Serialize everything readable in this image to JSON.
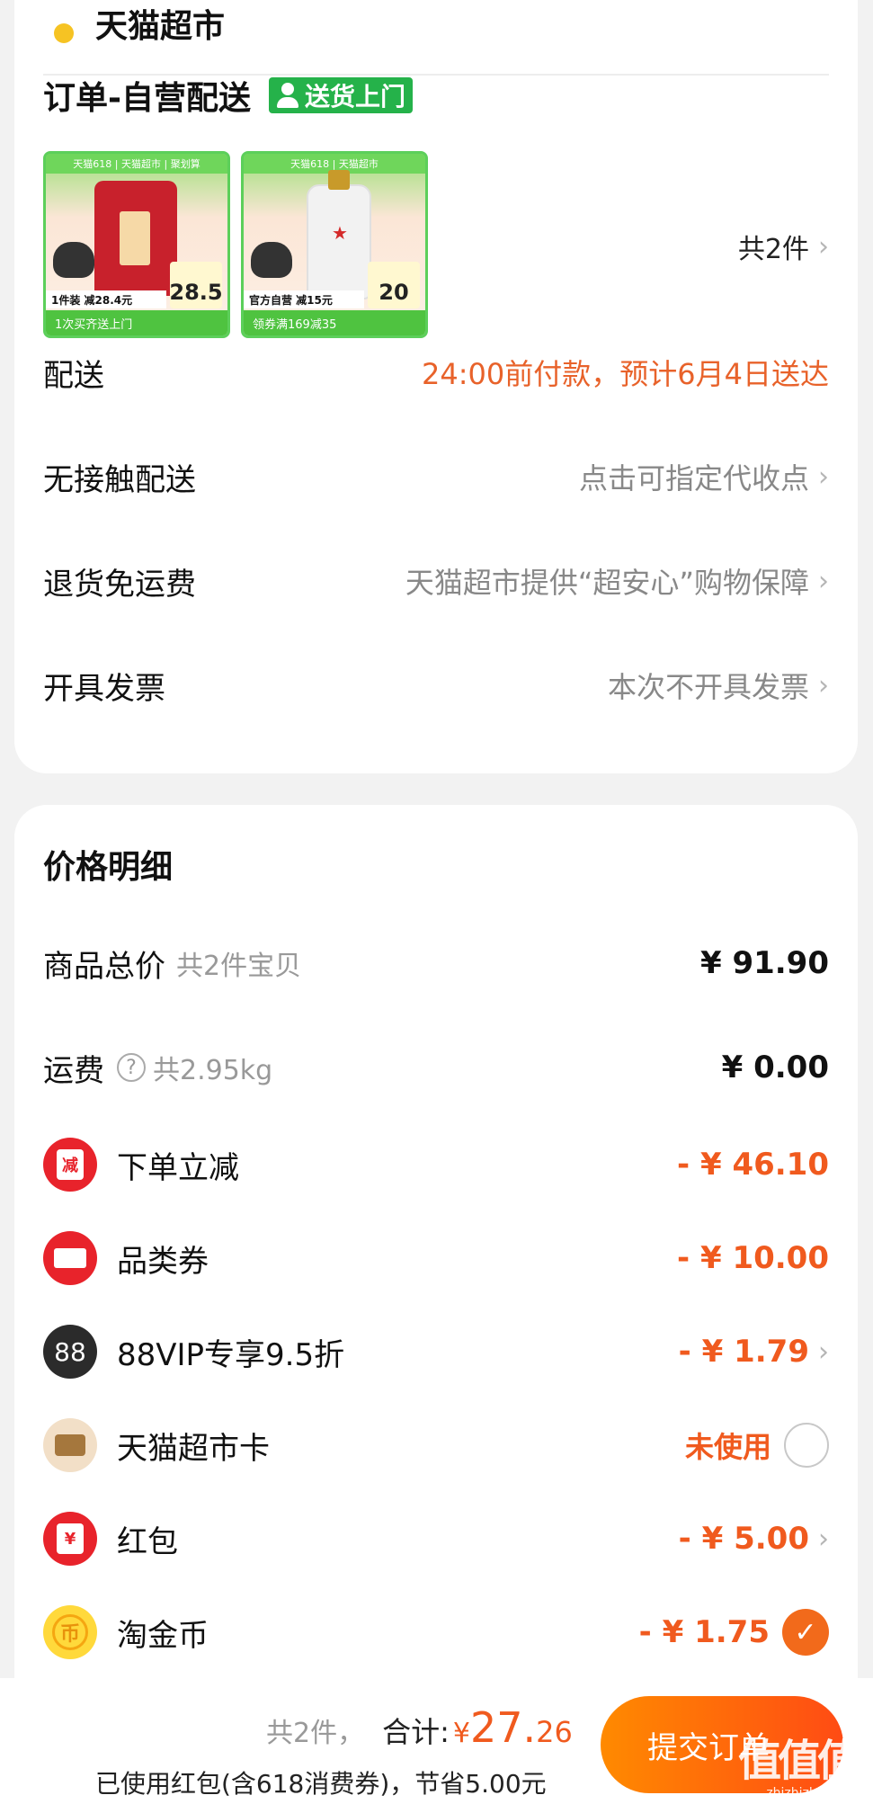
{
  "store": {
    "name": "天猫超市"
  },
  "order_section": {
    "title": "订单-自营配送",
    "badge": "送货上门"
  },
  "products": [
    {
      "top": "天猫618 | 天猫超市 | 聚划算",
      "promo": "1件装 减28.4元",
      "price": "28.5",
      "bottom": "1次买齐送上门"
    },
    {
      "top": "天猫618 | 天猫超市",
      "promo": "官方自营 减15元",
      "price": "20",
      "bottom": "领券满169减35"
    }
  ],
  "products_count": "共2件",
  "rows": {
    "delivery": {
      "label": "配送",
      "value": "24:00前付款，预计6月4日送达"
    },
    "contactless": {
      "label": "无接触配送",
      "value": "点击可指定代收点"
    },
    "return_shipping": {
      "label": "退货免运费",
      "value": "天猫超市提供“超安心”购物保障"
    },
    "invoice": {
      "label": "开具发票",
      "value": "本次不开具发票"
    }
  },
  "price_detail": {
    "title": "价格明细",
    "goods_total": {
      "label": "商品总价",
      "sub": "共2件宝贝",
      "amount": "¥ 91.90"
    },
    "shipping": {
      "label": "运费",
      "sub": "共2.95kg",
      "amount": "¥ 0.00"
    },
    "discounts": [
      {
        "label": "下单立减",
        "amount": "- ¥ 46.10",
        "icon": "instant-discount-icon"
      },
      {
        "label": "品类券",
        "amount": "- ¥ 10.00",
        "icon": "coupon-icon"
      },
      {
        "label": "88VIP专享9.5折",
        "amount": "- ¥ 1.79",
        "icon": "88vip-icon",
        "icon_text": "88"
      },
      {
        "label": "天猫超市卡",
        "amount": "未使用",
        "icon": "card-icon"
      },
      {
        "label": "红包",
        "amount": "- ¥ 5.00",
        "icon": "red-packet-icon",
        "icon_text": "¥"
      },
      {
        "label": "淘金币",
        "amount": "- ¥ 1.75",
        "icon": "gold-coin-icon",
        "icon_text": "币"
      }
    ]
  },
  "footer": {
    "count": "共2件，",
    "total_label": "合计:",
    "currency": "¥",
    "total_int": "27.",
    "total_dec": "26",
    "note": "已使用红包(含618消费券)，节省5.00元",
    "submit": "提交订单"
  },
  "watermark": {
    "glyph": "值值值",
    "url": "zhizhizhi.com"
  },
  "colors": {
    "accent": "#f05a1e",
    "green": "#25b24a",
    "button_start": "#ff8a00",
    "button_end": "#ff4b14"
  }
}
